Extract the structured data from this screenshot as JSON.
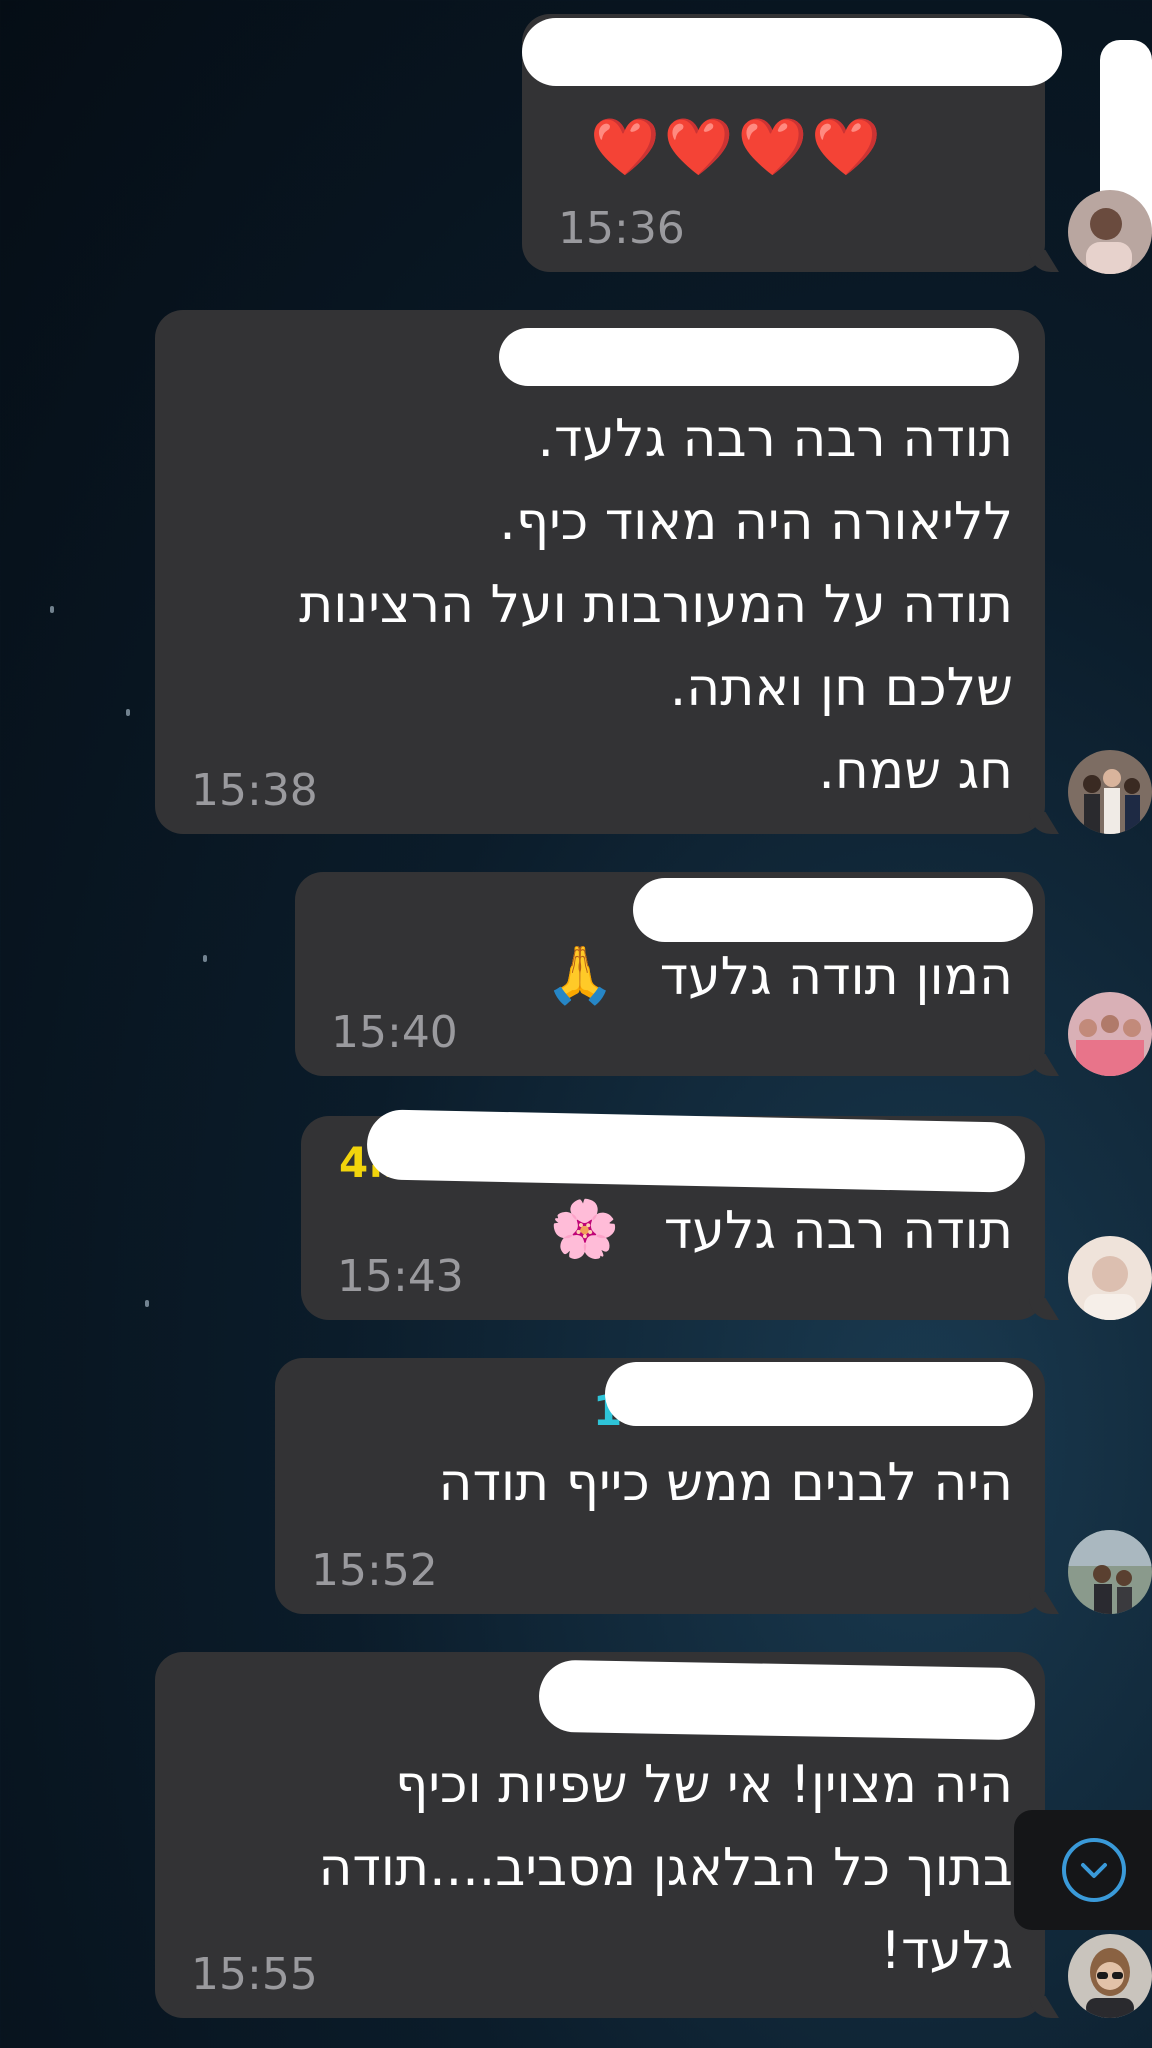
{
  "colors": {
    "bubble": "#333335",
    "text": "#ffffff",
    "time": "#9a9a9e",
    "accent": "#3a9ad9"
  },
  "messages": [
    {
      "sender": "",
      "sender_color": "#c87ee8",
      "lines": [],
      "emoji": "❤️❤️❤️❤️",
      "time": "15:36",
      "avatar": "avatar-woman-icon"
    },
    {
      "sender": "",
      "sender_color": "#8f8fee",
      "lines": [
        "תודה רבה רבה גלעד.",
        "לליאורה היה מאוד כיף.",
        "תודה על המעורבות ועל הרצינות",
        "שלכם חן ואתה.",
        "חג שמח."
      ],
      "time": "15:38",
      "avatar": "avatar-family-icon"
    },
    {
      "sender": "",
      "sender_color": "#4fd15a",
      "lines": [
        "המון תודה גלעד"
      ],
      "emoji": "🙏",
      "time": "15:40",
      "avatar": "avatar-group-icon"
    },
    {
      "sender": "4ה",
      "sender_color": "#f2d40c",
      "lines": [
        "תודה רבה גלעד"
      ],
      "emoji": "🌸",
      "time": "15:43",
      "avatar": "avatar-light-icon"
    },
    {
      "sender": "1",
      "sender_color": "#2ec4d8",
      "lines": [
        "היה לבנים ממש כייף תודה"
      ],
      "time": "15:52",
      "avatar": "avatar-outdoor-icon"
    },
    {
      "sender": "",
      "sender_color": "#4fd15a",
      "lines": [
        "היה מצוין! אי של שפיות וכיף",
        "בתוך כל הבלאגן מסביב....תודה",
        "גלעד!"
      ],
      "time": "15:55",
      "avatar": "avatar-sunglasses-icon"
    }
  ],
  "scroll_button": {
    "icon": "chevron-down-icon"
  }
}
